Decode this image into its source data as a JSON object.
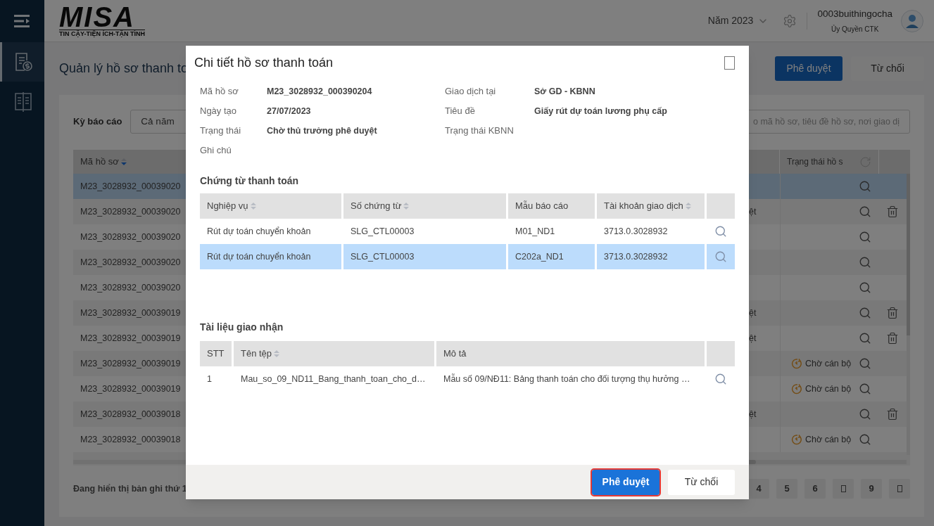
{
  "sidebar": {
    "items": [
      {
        "kind": "payment",
        "selected": true
      },
      {
        "kind": "book",
        "selected": false
      }
    ]
  },
  "header": {
    "logo": {
      "name": "MISA",
      "tagline": "TIN CẬY-TIỆN ÍCH-TẬN TÌNH"
    },
    "year": "Năm 2023",
    "user": {
      "name": "0003buithingocha",
      "role": "Ủy Quyền CTK"
    }
  },
  "page": {
    "title": "Quản lý hồ sơ thanh to",
    "actions": [
      {
        "label": "Phê duyệt",
        "primary": true
      },
      {
        "label": "Từ chối",
        "primary": false
      }
    ]
  },
  "filter": {
    "label": "Kỳ báo cáo",
    "period": "Cả năm",
    "search_placeholder": "o mã hồ sơ, tiêu đề hồ sơ, nơi giao dị"
  },
  "table": {
    "columns": [
      {
        "label": "Mã hồ sơ",
        "sortable": true,
        "sorted_descending": true
      },
      {
        "label": "Trạng thái hồ s",
        "sortable": false
      }
    ],
    "rows": [
      {
        "code": "M23_3028932_00039020",
        "selected": true,
        "deletable": false
      },
      {
        "code": "M23_3028932_00039020",
        "column_2": "ệt",
        "selected": false,
        "deletable": true
      },
      {
        "code": "M23_3028932_00039020",
        "selected": false,
        "deletable": false
      },
      {
        "code": "M23_3028932_00039020",
        "selected": false,
        "deletable": false
      },
      {
        "code": "M23_3028932_00039020",
        "selected": false,
        "deletable": false
      },
      {
        "code": "M23_3028932_00039019",
        "column_2": "ệt",
        "selected": false,
        "deletable": true
      },
      {
        "code": "M23_3028932_00039019",
        "column_2": "ệt",
        "selected": false,
        "deletable": true
      },
      {
        "code": "M23_3028932_00039019",
        "status": "Chờ cán bộ",
        "selected": false,
        "deletable": false
      },
      {
        "code": "M23_3028932_00039019",
        "status": "Chờ cán bộ",
        "selected": false,
        "deletable": false
      },
      {
        "code": "M23_3028932_00039018",
        "column_2": "ệt",
        "selected": false,
        "deletable": true
      },
      {
        "code": "M23_3028932_00039018",
        "status": "Chờ cán bộ",
        "selected": false,
        "deletable": false
      }
    ]
  },
  "pagination": {
    "summary": "Đang hiển thị bản ghi thứ 1",
    "pages": [
      {
        "kind": "page",
        "label": "4"
      },
      {
        "kind": "page",
        "label": "5"
      },
      {
        "kind": "page",
        "label": "6"
      },
      {
        "kind": "icon"
      },
      {
        "kind": "page",
        "label": "9"
      },
      {
        "kind": "icon"
      }
    ]
  },
  "dialog": {
    "title": "Chi tiết hồ sơ thanh toán",
    "fields": [
      {
        "label": "Mã hồ sơ",
        "value": "M23_3028932_000390204"
      },
      {
        "label": "Giao dịch tại",
        "value": "Sở GD - KBNN"
      },
      {
        "label": "Ngày tạo",
        "value": "27/07/2023"
      },
      {
        "label": "Tiêu đề",
        "value": "Giấy rút dự toán lương phụ cấp"
      },
      {
        "label": "Trạng thái",
        "value": "Chờ thủ trưởng phê duyệt"
      },
      {
        "label": "Trạng thái KBNN"
      },
      {
        "label": "Ghi chú"
      }
    ],
    "vouchers": {
      "title": "Chứng từ thanh toán",
      "columns": [
        {
          "label": "Nghiệp vụ",
          "sortable": true
        },
        {
          "label": "Số chứng từ",
          "sortable": true
        },
        {
          "label": "Mẫu báo cáo",
          "sortable": false
        },
        {
          "label": "Tài khoản giao dịch",
          "sortable": true
        }
      ],
      "rows": [
        {
          "cells": [
            "Rút dự toán chuyển khoản",
            "SLG_CTL00003",
            "M01_ND1",
            "3713.0.3028932"
          ],
          "selected": false
        },
        {
          "cells": [
            "Rút dự toán chuyển khoản",
            "SLG_CTL00003",
            "C202a_ND1",
            "3713.0.3028932"
          ],
          "selected": true
        }
      ]
    },
    "documents": {
      "title": "Tài liệu giao nhận",
      "columns": [
        {
          "label": "STT",
          "sortable": false
        },
        {
          "label": "Tên tệp",
          "sortable": true
        },
        {
          "label": "Mô tả",
          "sortable": false
        }
      ],
      "rows": [
        {
          "cells": [
            "1",
            "Mau_so_09_ND11_Bang_thanh_toan_cho_d…",
            "Mẫu số 09/NĐ11: Bảng thanh toán cho đối tượng thụ hưởng …"
          ],
          "selected": false
        }
      ]
    },
    "actions": [
      {
        "label": "Phê duyệt",
        "primary": true,
        "highlighted": true
      },
      {
        "label": "Từ chối",
        "primary": false,
        "highlighted": false
      }
    ]
  }
}
